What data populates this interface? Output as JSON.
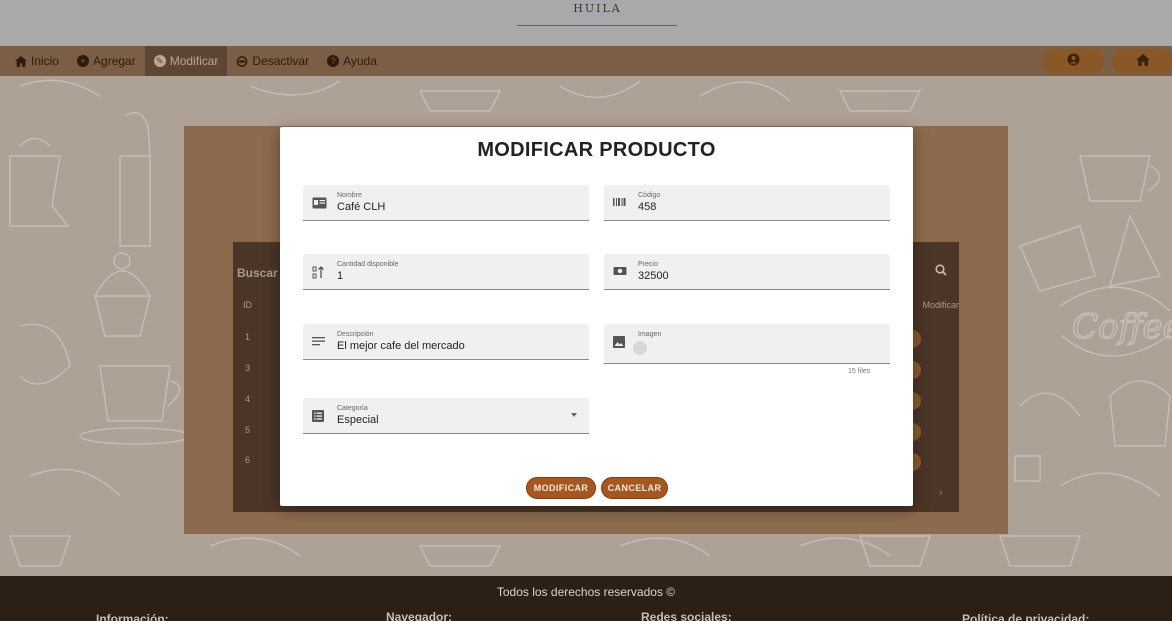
{
  "header": {
    "brand": "HUILA"
  },
  "nav": {
    "items": [
      {
        "label": "Inicio",
        "icon": "home-icon"
      },
      {
        "label": "Agregar",
        "icon": "add-circle-icon"
      },
      {
        "label": "Modificar",
        "icon": "edit-circle-icon",
        "active": true
      },
      {
        "label": "Desactivar",
        "icon": "toggle-off-icon"
      },
      {
        "label": "Ayuda",
        "icon": "help-circle-icon"
      }
    ],
    "right": [
      {
        "icon": "account-icon"
      },
      {
        "icon": "home-icon"
      }
    ]
  },
  "table": {
    "search_label": "Buscar",
    "id_header": "ID",
    "modify_header": "Modificar",
    "ids": [
      "1",
      "3",
      "4",
      "5",
      "6"
    ]
  },
  "modal": {
    "title": "MODIFICAR PRODUCTO",
    "fields": {
      "nombre": {
        "label": "Nombre",
        "value": "Café CLH",
        "icon": "id-card-icon"
      },
      "codigo": {
        "label": "Código",
        "value": "458",
        "icon": "barcode-icon"
      },
      "cantidad": {
        "label": "Cantidad disponible",
        "value": "1",
        "icon": "sort-numeric-icon"
      },
      "precio": {
        "label": "Precio",
        "value": "32500",
        "icon": "money-icon"
      },
      "descripcion": {
        "label": "Descripción",
        "value": "El mejor cafe del mercado",
        "icon": "notes-icon"
      },
      "imagen": {
        "label": "Imagen",
        "value": "",
        "icon": "image-icon",
        "files_count": "15 files"
      },
      "categoria": {
        "label": "Categoría",
        "value": "Especial",
        "icon": "list-icon"
      }
    },
    "buttons": {
      "modify": "MODIFICAR",
      "cancel": "CANCELAR"
    }
  },
  "footer": {
    "rights": "Todos los derechos reservados ©",
    "sections": [
      "Información:",
      "Navegador:",
      "Redes sociales:",
      "Política de privacidad:"
    ]
  },
  "colors": {
    "nav_bg": "#7a5e45",
    "accent_button": "#a6561f",
    "footer_bg": "#2b1f16",
    "panel_bg": "#8c6a4d"
  }
}
